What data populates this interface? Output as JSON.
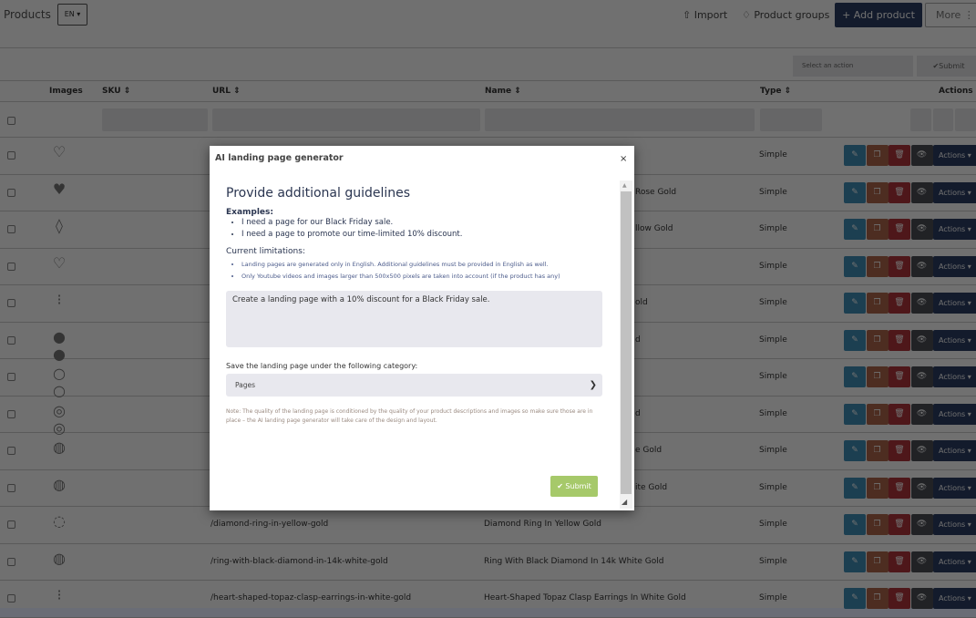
{
  "header": {
    "title": "Products",
    "lang": "EN ▾",
    "import": "⇧ Import",
    "groups": "♢ Product groups",
    "add": "+ Add product",
    "more": "More ⋮"
  },
  "toolbar": {
    "select_placeholder": "Select an action",
    "submit": "✔Submit"
  },
  "columns": {
    "images": "Images",
    "sku": "SKU ⇕",
    "url": "URL ⇕",
    "name": "Name ⇕",
    "type": "Type ⇕",
    "actions": "Actions"
  },
  "row_action_label": "Actions ▾",
  "rows": [
    {
      "url": "",
      "name": "",
      "type": "Simple"
    },
    {
      "url": "",
      "name": "Rose Gold",
      "type": "Simple"
    },
    {
      "url": "",
      "name": "llow Gold",
      "type": "Simple"
    },
    {
      "url": "",
      "name": "",
      "type": "Simple"
    },
    {
      "url": "",
      "name": "old",
      "type": "Simple"
    },
    {
      "url": "",
      "name": "d",
      "type": "Simple"
    },
    {
      "url": "",
      "name": "",
      "type": "Simple"
    },
    {
      "url": "",
      "name": "d",
      "type": "Simple"
    },
    {
      "url": "",
      "name": "e Gold",
      "type": "Simple"
    },
    {
      "url": "",
      "name": "ite Gold",
      "type": "Simple"
    },
    {
      "url": "/diamond-ring-in-yellow-gold",
      "name": "Diamond Ring In Yellow Gold",
      "type": "Simple"
    },
    {
      "url": "/ring-with-black-diamond-in-14k-white-gold",
      "name": "Ring With Black Diamond In 14k White Gold",
      "type": "Simple"
    },
    {
      "url": "/heart-shaped-topaz-clasp-earrings-in-white-gold",
      "name": "Heart-Shaped Topaz Clasp Earrings In White Gold",
      "type": "Simple"
    }
  ],
  "colors": {
    "edit": "#3f8fb8",
    "copy": "#b0664a",
    "delete": "#b2343a",
    "view": "#4a4d55",
    "actions": "#2b3d63",
    "submit": "#a6c96a"
  },
  "modal": {
    "title": "AI landing page generator",
    "close": "×",
    "heading": "Provide additional guidelines",
    "examples_label": "Examples:",
    "examples": [
      "I need a page for our Black Friday sale.",
      "I need a page to promote our time-limited 10% discount."
    ],
    "limitations_label": "Current limitations:",
    "limitations": [
      "Landing pages are generated only in English. Additional guidelines must be provided in English as well.",
      "Only Youtube videos and images larger than 500x500 pixels are taken into account (if the product has any)"
    ],
    "textarea_value": "Create a landing page with a 10% discount for a Black Friday sale.",
    "category_label": "Save the landing page under the following category:",
    "category_value": "Pages",
    "note": "Note: The quality of the landing page is conditioned by the quality of your product descriptions and images so make sure those are in place – the AI landing page generator will take care of the design and layout.",
    "submit": "✔ Submit"
  }
}
